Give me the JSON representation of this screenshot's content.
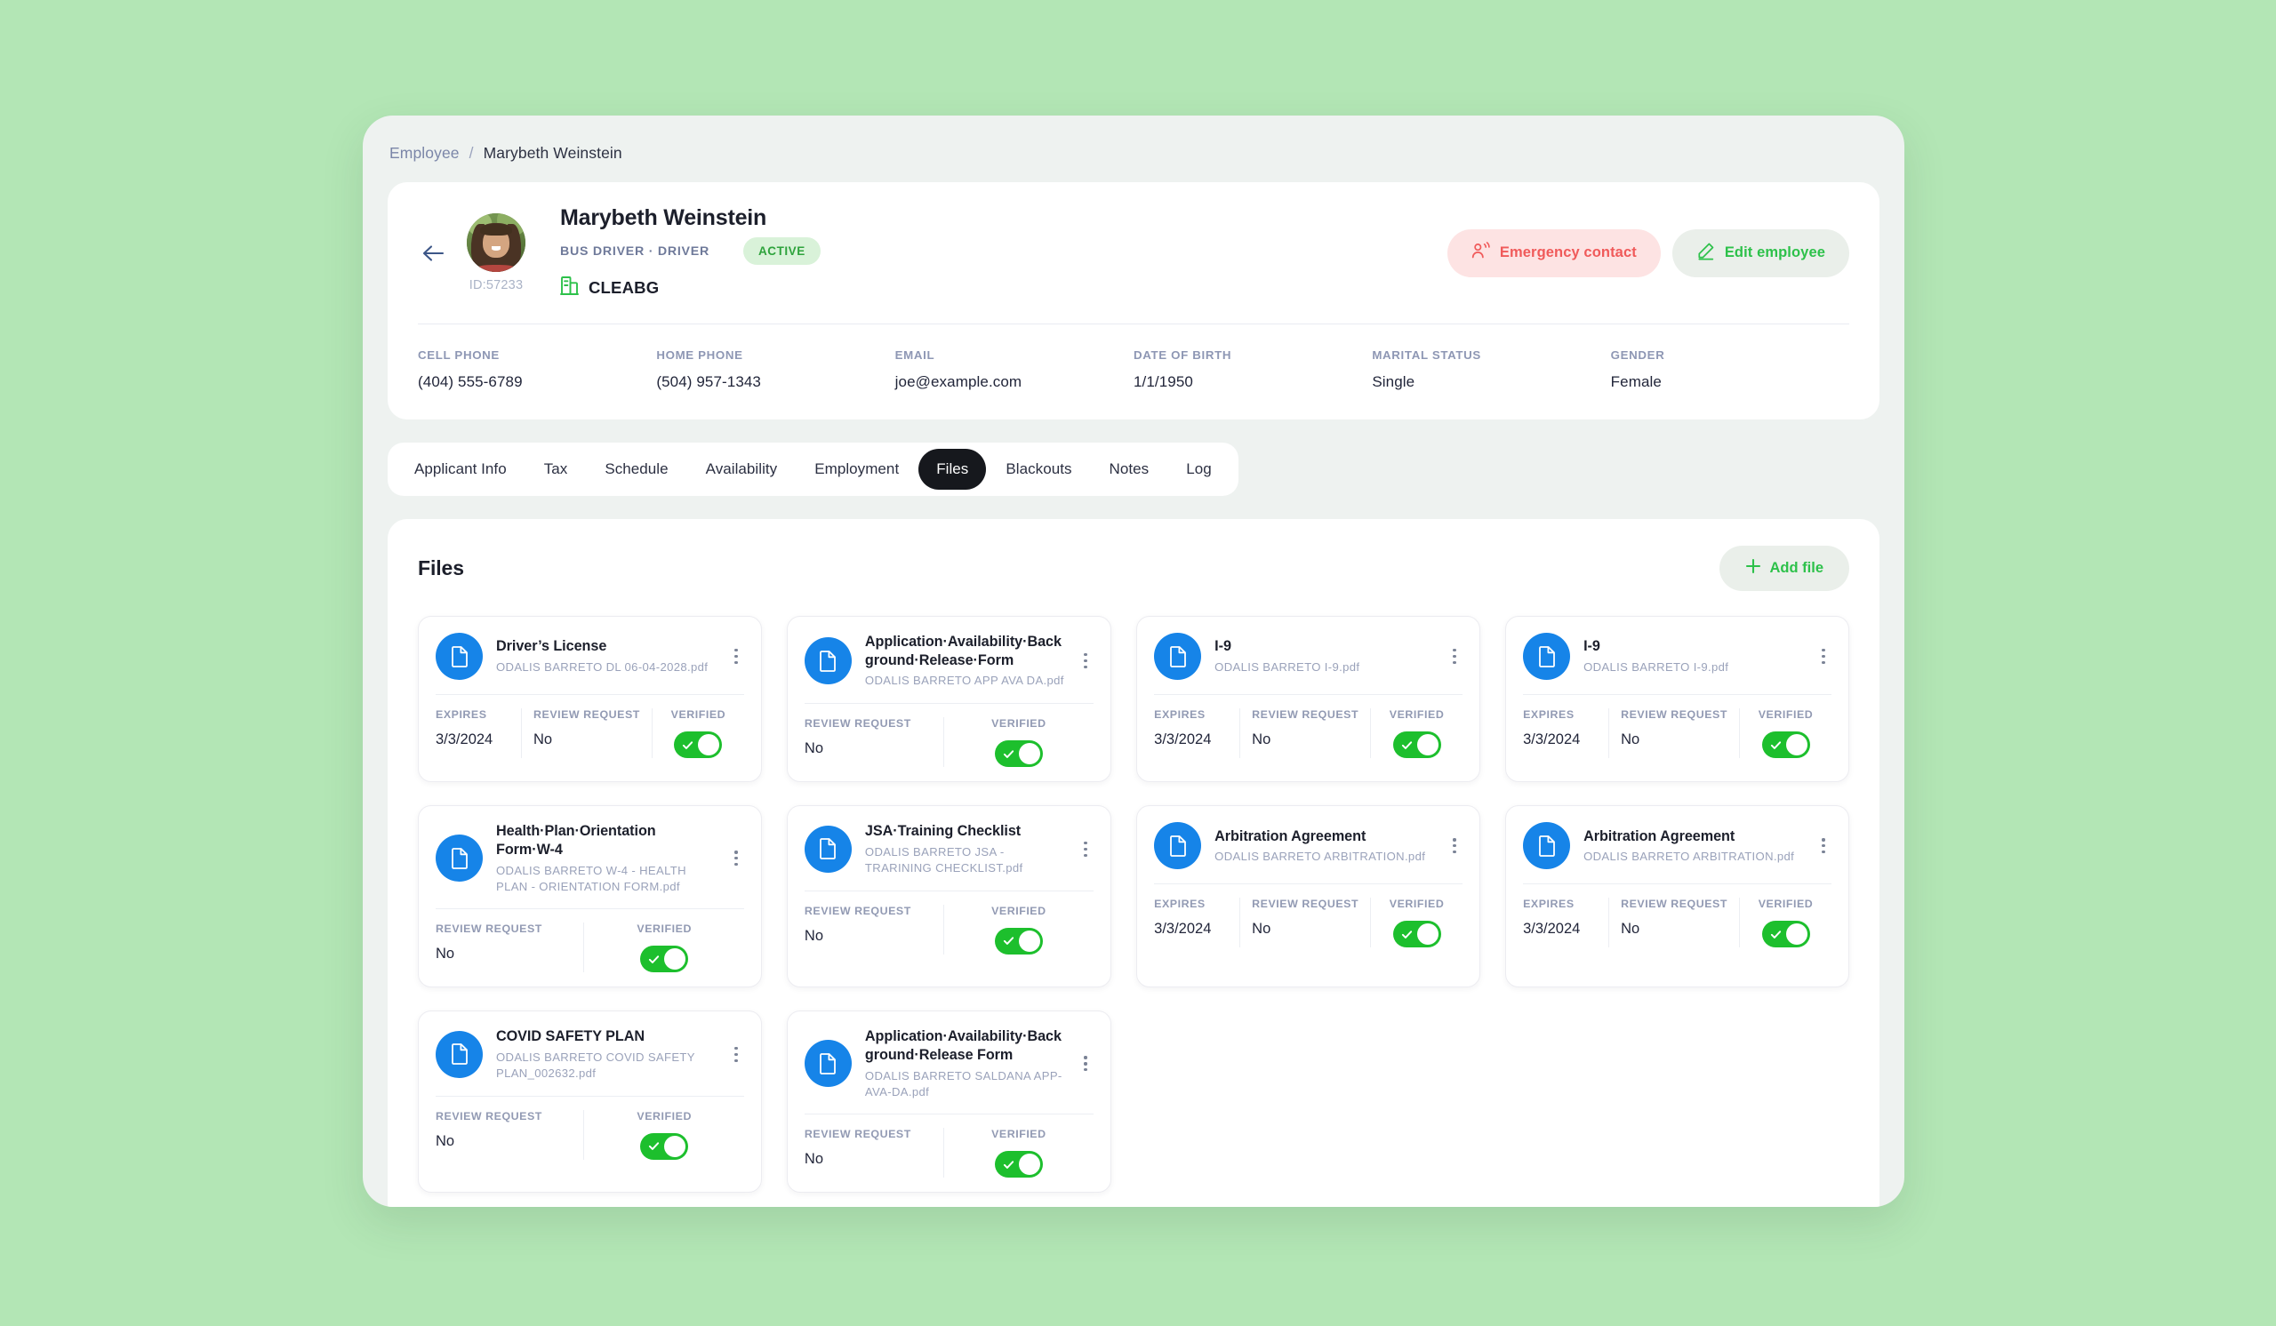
{
  "theme": {
    "page_background": "#b3e6b5",
    "app_background": "#eef2f0",
    "accent_green": "#2dc14a",
    "accent_blue": "#1684e8",
    "toggle_green": "#1dbf2d",
    "danger_red": "#f05a5a",
    "active_badge_bg": "#d9f2d9"
  },
  "breadcrumb": {
    "root": "Employee",
    "separator": "/",
    "current": "Marybeth Weinstein"
  },
  "profile": {
    "back_icon": "arrow-left-icon",
    "avatar_icon": "employee-avatar",
    "employee_id": "ID:57233",
    "name": "Marybeth Weinstein",
    "role": "BUS DRIVER · DRIVER",
    "status": "ACTIVE",
    "location_icon": "building-icon",
    "location": "CLEABG",
    "actions": {
      "emergency_label": "Emergency contact",
      "emergency_icon": "person-signal-icon",
      "edit_label": "Edit employee",
      "edit_icon": "pencil-icon"
    },
    "details": [
      {
        "label": "CELL PHONE",
        "value": "(404) 555-6789"
      },
      {
        "label": "HOME PHONE",
        "value": "(504) 957-1343"
      },
      {
        "label": "EMAIL",
        "value": "joe@example.com"
      },
      {
        "label": "DATE OF BIRTH",
        "value": "1/1/1950"
      },
      {
        "label": "MARITAL STATUS",
        "value": "Single"
      },
      {
        "label": "GENDER",
        "value": "Female"
      }
    ]
  },
  "tabs": [
    {
      "label": "Applicant Info",
      "active": false
    },
    {
      "label": "Tax",
      "active": false
    },
    {
      "label": "Schedule",
      "active": false
    },
    {
      "label": "Availability",
      "active": false
    },
    {
      "label": "Employment",
      "active": false
    },
    {
      "label": "Files",
      "active": true
    },
    {
      "label": "Blackouts",
      "active": false
    },
    {
      "label": "Notes",
      "active": false
    },
    {
      "label": "Log",
      "active": false
    }
  ],
  "files_panel": {
    "title": "Files",
    "add_button_label": "Add file",
    "add_button_icon": "plus-icon",
    "meta_labels": {
      "expires": "EXPIRES",
      "review_request": "REVIEW REQUEST",
      "verified": "VERIFIED"
    },
    "files": [
      {
        "icon": "document-icon",
        "title": "Driver’s License",
        "filename": "ODALIS BARRETO DL 06-04-2028.pdf",
        "expires": "3/3/2024",
        "review_request": "No",
        "verified": true
      },
      {
        "icon": "document-icon",
        "title": "Application·Availability·Background·Release·Form",
        "filename": "ODALIS BARRETO APP AVA DA.pdf",
        "expires": null,
        "review_request": "No",
        "verified": true
      },
      {
        "icon": "document-icon",
        "title": "I-9",
        "filename": "ODALIS BARRETO I-9.pdf",
        "expires": "3/3/2024",
        "review_request": "No",
        "verified": true
      },
      {
        "icon": "document-icon",
        "title": "I-9",
        "filename": "ODALIS BARRETO I-9.pdf",
        "expires": "3/3/2024",
        "review_request": "No",
        "verified": true
      },
      {
        "icon": "document-icon",
        "title": "Health·Plan·Orientation Form·W-4",
        "filename": "ODALIS BARRETO W-4 - HEALTH PLAN - ORIENTATION FORM.pdf",
        "expires": null,
        "review_request": "No",
        "verified": true
      },
      {
        "icon": "document-icon",
        "title": "JSA·Training Checklist",
        "filename": "ODALIS BARRETO JSA - TRARINING CHECKLIST.pdf",
        "expires": null,
        "review_request": "No",
        "verified": true
      },
      {
        "icon": "document-icon",
        "title": "Arbitration Agreement",
        "filename": "ODALIS BARRETO ARBITRATION.pdf",
        "expires": "3/3/2024",
        "review_request": "No",
        "verified": true
      },
      {
        "icon": "document-icon",
        "title": "Arbitration Agreement",
        "filename": "ODALIS BARRETO ARBITRATION.pdf",
        "expires": "3/3/2024",
        "review_request": "No",
        "verified": true
      },
      {
        "icon": "document-icon",
        "title": "COVID SAFETY PLAN",
        "filename": "ODALIS BARRETO COVID SAFETY PLAN_002632.pdf",
        "expires": null,
        "review_request": "No",
        "verified": true
      },
      {
        "icon": "document-icon",
        "title": "Application·Availability·Background·Release Form",
        "filename": "ODALIS BARRETO SALDANA APP-AVA-DA.pdf",
        "expires": null,
        "review_request": "No",
        "verified": true
      }
    ]
  }
}
